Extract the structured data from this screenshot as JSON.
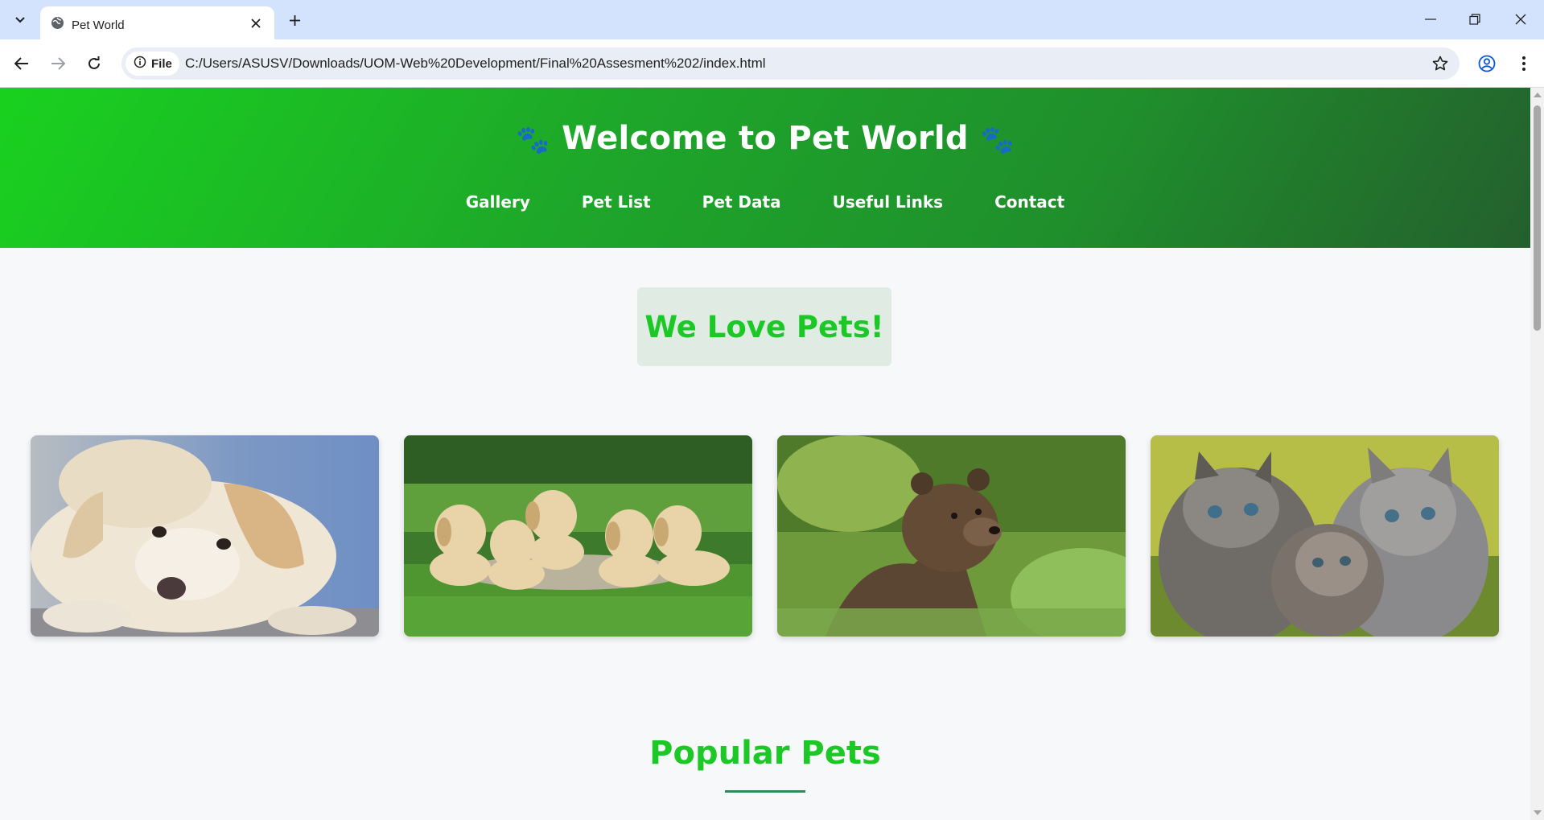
{
  "browser": {
    "tab_title": "Pet World",
    "url": "C:/Users/ASUSV/Downloads/UOM-Web%20Development/Final%20Assesment%202/index.html",
    "security_chip": "File"
  },
  "header": {
    "title": "Welcome to Pet World",
    "paw_symbol": "🐾",
    "nav": [
      "Gallery",
      "Pet List",
      "Pet Data",
      "Useful Links",
      "Contact"
    ]
  },
  "hero": {
    "text": "We Love Pets!"
  },
  "gallery": {
    "images": [
      "labrador-puppy-photo",
      "five-puppies-on-grass-photo",
      "bear-cub-photo",
      "three-kittens-photo"
    ]
  },
  "sections": {
    "popular_title": "Popular Pets"
  },
  "colors": {
    "accent": "#1bc825",
    "header_start": "#19d11f",
    "header_end": "#245f2d",
    "hero_bg": "#e0ebe4",
    "rule": "#2e8a57"
  }
}
